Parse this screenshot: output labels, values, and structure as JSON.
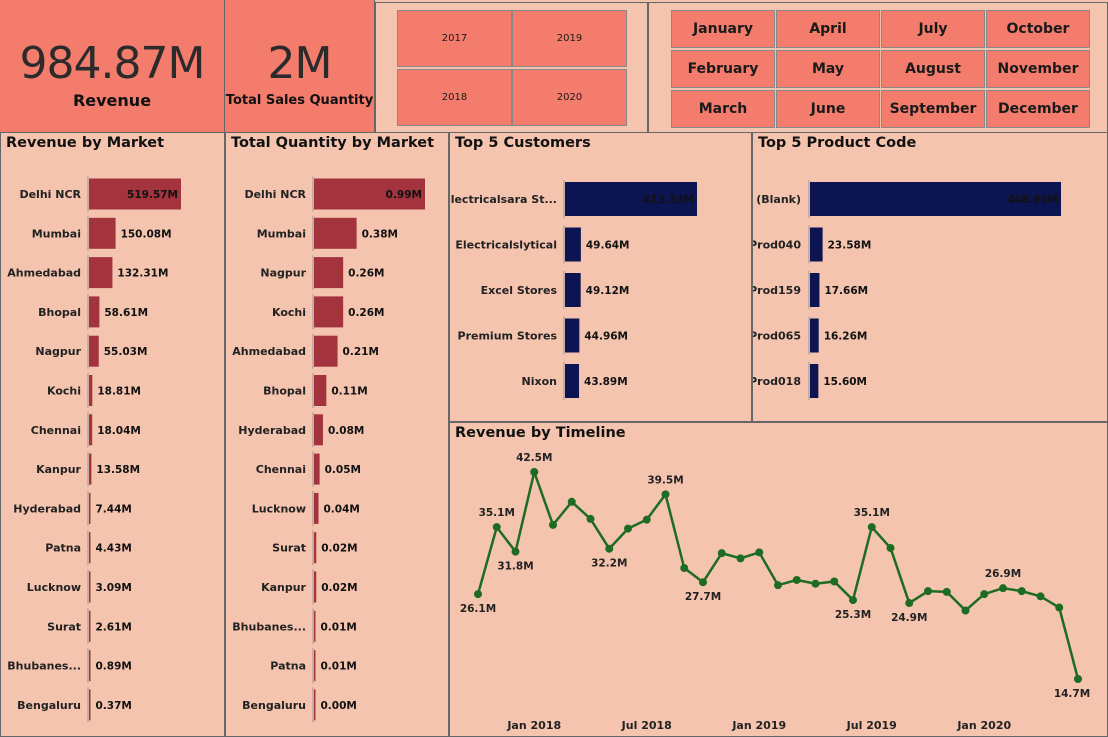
{
  "kpis": {
    "revenue": {
      "value": "984.87M",
      "label": "Revenue"
    },
    "quantity": {
      "value": "2M",
      "label": "Total Sales Quantity"
    }
  },
  "year_slicer": [
    "2017",
    "2019",
    "2018",
    "2020"
  ],
  "month_slicer": [
    "January",
    "April",
    "July",
    "October",
    "February",
    "May",
    "August",
    "November",
    "March",
    "June",
    "September",
    "December"
  ],
  "colors": {
    "kpi_bg": "#f47c6c",
    "panel_bg": "#f5c4ae",
    "market_bar": "#a3333d",
    "top5_bar": "#0c1452",
    "timeline_line": "#1e6b22"
  },
  "chart_data": [
    {
      "type": "bar",
      "orientation": "horizontal",
      "title": "Revenue by Market",
      "categories": [
        "Delhi NCR",
        "Mumbai",
        "Ahmedabad",
        "Bhopal",
        "Nagpur",
        "Kochi",
        "Chennai",
        "Kanpur",
        "Hyderabad",
        "Patna",
        "Lucknow",
        "Surat",
        "Bhubanes...",
        "Bengaluru"
      ],
      "values": [
        519.57,
        150.08,
        132.31,
        58.61,
        55.03,
        18.81,
        18.04,
        13.58,
        7.44,
        4.43,
        3.09,
        2.61,
        0.89,
        0.37
      ],
      "labels": [
        "519.57M",
        "150.08M",
        "132.31M",
        "58.61M",
        "55.03M",
        "18.81M",
        "18.04M",
        "13.58M",
        "7.44M",
        "4.43M",
        "3.09M",
        "2.61M",
        "0.89M",
        "0.37M"
      ]
    },
    {
      "type": "bar",
      "orientation": "horizontal",
      "title": "Total Quantity by Market",
      "categories": [
        "Delhi NCR",
        "Mumbai",
        "Nagpur",
        "Kochi",
        "Ahmedabad",
        "Bhopal",
        "Hyderabad",
        "Chennai",
        "Lucknow",
        "Surat",
        "Kanpur",
        "Bhubanes...",
        "Patna",
        "Bengaluru"
      ],
      "values": [
        0.99,
        0.38,
        0.26,
        0.26,
        0.21,
        0.11,
        0.08,
        0.05,
        0.04,
        0.02,
        0.02,
        0.01,
        0.01,
        0.004
      ],
      "labels": [
        "0.99M",
        "0.38M",
        "0.26M",
        "0.26M",
        "0.21M",
        "0.11M",
        "0.08M",
        "0.05M",
        "0.04M",
        "0.02M",
        "0.02M",
        "0.01M",
        "0.01M",
        "0.00M"
      ]
    },
    {
      "type": "bar",
      "orientation": "horizontal",
      "title": "Top 5 Customers",
      "categories": [
        "Electricalsara St...",
        "Electricalslytical",
        "Excel Stores",
        "Premium Stores",
        "Nixon"
      ],
      "values": [
        413.33,
        49.64,
        49.12,
        44.96,
        43.89
      ],
      "labels": [
        "413.33M",
        "49.64M",
        "49.12M",
        "44.96M",
        "43.89M"
      ]
    },
    {
      "type": "bar",
      "orientation": "horizontal",
      "title": "Top 5 Product Code",
      "categories": [
        "(Blank)",
        "Prod040",
        "Prod159",
        "Prod065",
        "Prod018"
      ],
      "values": [
        468.96,
        23.58,
        17.66,
        16.26,
        15.6
      ],
      "labels": [
        "468.96M",
        "23.58M",
        "17.66M",
        "16.26M",
        "15.60M"
      ]
    },
    {
      "type": "line",
      "title": "Revenue by Timeline",
      "x_ticks": [
        "Jan 2018",
        "Jul 2018",
        "Jan 2019",
        "Jul 2019",
        "Jan 2020"
      ],
      "x": [
        "2017-10",
        "2017-11",
        "2017-12",
        "2018-01",
        "2018-02",
        "2018-03",
        "2018-04",
        "2018-05",
        "2018-06",
        "2018-07",
        "2018-08",
        "2018-09",
        "2018-10",
        "2018-11",
        "2018-12",
        "2019-01",
        "2019-02",
        "2019-03",
        "2019-04",
        "2019-05",
        "2019-06",
        "2019-07",
        "2019-08",
        "2019-09",
        "2019-10",
        "2019-11",
        "2019-12",
        "2020-01",
        "2020-02",
        "2020-03",
        "2020-04",
        "2020-05",
        "2020-06"
      ],
      "values": [
        26.1,
        35.1,
        31.8,
        42.5,
        35.4,
        38.5,
        36.2,
        32.2,
        34.9,
        36.1,
        39.5,
        29.6,
        27.7,
        31.6,
        30.9,
        31.7,
        27.3,
        28.0,
        27.5,
        27.8,
        25.3,
        35.1,
        32.3,
        24.9,
        26.5,
        26.4,
        23.9,
        26.1,
        26.9,
        26.5,
        25.8,
        24.3,
        14.7
      ],
      "point_labels": {
        "0": "26.1M",
        "1": "35.1M",
        "2": "31.8M",
        "3": "42.5M",
        "7": "32.2M",
        "10": "39.5M",
        "12": "27.7M",
        "20": "25.3M",
        "21": "35.1M",
        "23": "24.9M",
        "28": "26.9M",
        "32": "14.7M"
      }
    }
  ]
}
